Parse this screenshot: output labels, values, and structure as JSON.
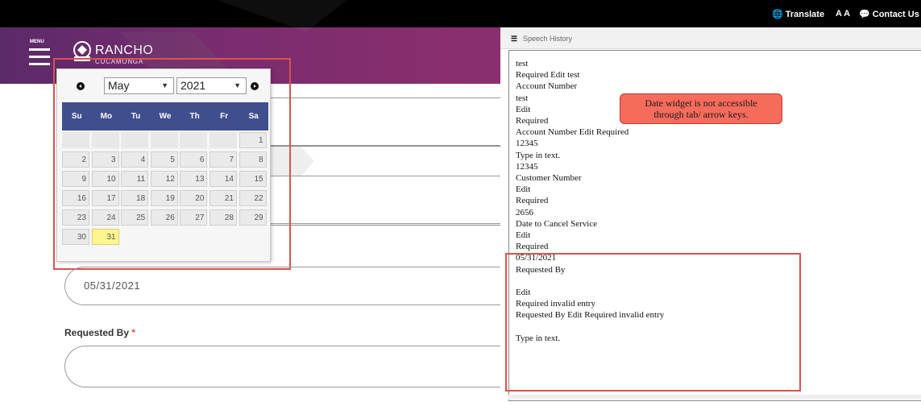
{
  "topbar": {
    "translate": "Translate",
    "text_size": "A A",
    "contact": "Contact Us"
  },
  "header": {
    "menu_label": "MENU",
    "logo_name": "RANCHO",
    "logo_sub": "CUCAMONGA"
  },
  "calendar": {
    "month": "May",
    "year": "2021",
    "weekdays": [
      "Su",
      "Mo",
      "Tu",
      "We",
      "Th",
      "Fr",
      "Sa"
    ],
    "days": [
      "1",
      "2",
      "3",
      "4",
      "5",
      "6",
      "7",
      "8",
      "9",
      "10",
      "11",
      "12",
      "13",
      "14",
      "15",
      "16",
      "17",
      "18",
      "19",
      "20",
      "21",
      "22",
      "23",
      "24",
      "25",
      "26",
      "27",
      "28",
      "29",
      "30",
      "31"
    ],
    "highlighted_day": "31"
  },
  "form": {
    "date_value": "05/31/2021",
    "requested_by_label": "Requested By",
    "required_marker": "*"
  },
  "speech_history": {
    "title": "Speech History",
    "lines": [
      "test",
      "Required Edit test",
      "Account Number",
      "test",
      "Edit",
      "Required",
      "Account Number Edit Required",
      "12345",
      "Type in text.",
      "12345",
      "Customer Number",
      "Edit",
      "Required",
      "2656",
      "Date to Cancel Service",
      "Edit",
      "Required",
      "05/31/2021",
      "Requested By",
      "",
      "Edit",
      "Required invalid entry",
      "Requested By Edit Required invalid entry",
      "",
      "Type in text."
    ]
  },
  "annotation": {
    "callout_line1": "Date widget is not accessible",
    "callout_line2": "through tab/ arrow keys."
  },
  "colors": {
    "accent_red": "#d9534f",
    "calendar_header": "#3f4e8d",
    "highlight": "#fdf58f",
    "callout": "#f56b5c",
    "hero_purple": "#7a2c6e"
  }
}
